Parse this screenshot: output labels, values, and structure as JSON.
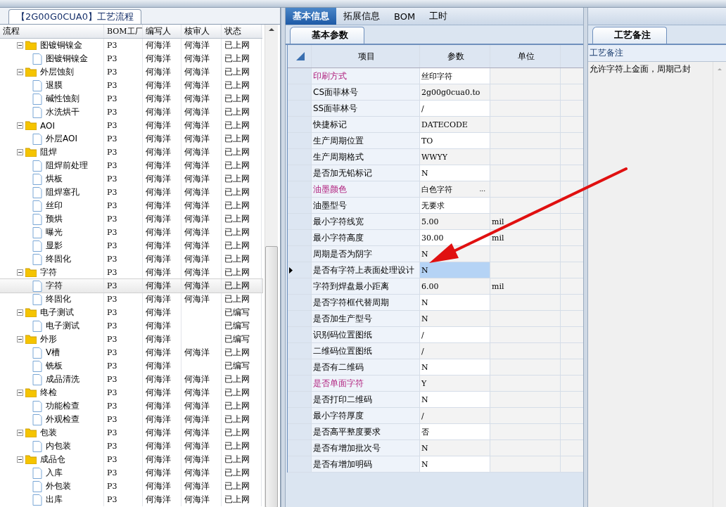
{
  "flow_panel": {
    "title": "【2G00G0CUA0】工艺流程",
    "columns": [
      "流程",
      "BOM工厂",
      "编写人",
      "核审人",
      "状态"
    ],
    "groups": [
      {
        "name": "图镀铜镍金",
        "bom": "P3",
        "writer": "何海洋",
        "reviewer": "何海洋",
        "status": "已上网",
        "expanded": true,
        "selected": false,
        "children": [
          {
            "name": "图镀铜镍金",
            "bom": "P3",
            "writer": "何海洋",
            "reviewer": "何海洋",
            "status": "已上网",
            "selected": false
          }
        ]
      },
      {
        "name": "外层蚀刻",
        "bom": "P3",
        "writer": "何海洋",
        "reviewer": "何海洋",
        "status": "已上网",
        "expanded": true,
        "selected": false,
        "children": [
          {
            "name": "退膜",
            "bom": "P3",
            "writer": "何海洋",
            "reviewer": "何海洋",
            "status": "已上网",
            "selected": false
          },
          {
            "name": "碱性蚀刻",
            "bom": "P3",
            "writer": "何海洋",
            "reviewer": "何海洋",
            "status": "已上网",
            "selected": false
          },
          {
            "name": "水洗烘干",
            "bom": "P3",
            "writer": "何海洋",
            "reviewer": "何海洋",
            "status": "已上网",
            "selected": false
          }
        ]
      },
      {
        "name": "AOI",
        "bom": "P3",
        "writer": "何海洋",
        "reviewer": "何海洋",
        "status": "已上网",
        "expanded": true,
        "selected": false,
        "children": [
          {
            "name": "外层AOI",
            "bom": "P3",
            "writer": "何海洋",
            "reviewer": "何海洋",
            "status": "已上网",
            "selected": false
          }
        ]
      },
      {
        "name": "阻焊",
        "bom": "P3",
        "writer": "何海洋",
        "reviewer": "何海洋",
        "status": "已上网",
        "expanded": true,
        "selected": false,
        "children": [
          {
            "name": "阻焊前处理",
            "bom": "P3",
            "writer": "何海洋",
            "reviewer": "何海洋",
            "status": "已上网",
            "selected": false
          },
          {
            "name": "烘板",
            "bom": "P3",
            "writer": "何海洋",
            "reviewer": "何海洋",
            "status": "已上网",
            "selected": false
          },
          {
            "name": "阻焊塞孔",
            "bom": "P3",
            "writer": "何海洋",
            "reviewer": "何海洋",
            "status": "已上网",
            "selected": false
          },
          {
            "name": "丝印",
            "bom": "P3",
            "writer": "何海洋",
            "reviewer": "何海洋",
            "status": "已上网",
            "selected": false
          },
          {
            "name": "预烘",
            "bom": "P3",
            "writer": "何海洋",
            "reviewer": "何海洋",
            "status": "已上网",
            "selected": false
          },
          {
            "name": "曝光",
            "bom": "P3",
            "writer": "何海洋",
            "reviewer": "何海洋",
            "status": "已上网",
            "selected": false
          },
          {
            "name": "显影",
            "bom": "P3",
            "writer": "何海洋",
            "reviewer": "何海洋",
            "status": "已上网",
            "selected": false
          },
          {
            "name": "终固化",
            "bom": "P3",
            "writer": "何海洋",
            "reviewer": "何海洋",
            "status": "已上网",
            "selected": false
          }
        ]
      },
      {
        "name": "字符",
        "bom": "P3",
        "writer": "何海洋",
        "reviewer": "何海洋",
        "status": "已上网",
        "expanded": true,
        "selected": false,
        "children": [
          {
            "name": "字符",
            "bom": "P3",
            "writer": "何海洋",
            "reviewer": "何海洋",
            "status": "已上网",
            "selected": true
          },
          {
            "name": "终固化",
            "bom": "P3",
            "writer": "何海洋",
            "reviewer": "何海洋",
            "status": "已上网",
            "selected": false
          }
        ]
      },
      {
        "name": "电子测试",
        "bom": "P3",
        "writer": "何海洋",
        "status": "已编写",
        "expanded": true,
        "selected": false,
        "children": [
          {
            "name": "电子测试",
            "bom": "P3",
            "writer": "何海洋",
            "status": "已编写",
            "selected": false
          }
        ]
      },
      {
        "name": "外形",
        "bom": "P3",
        "writer": "何海洋",
        "status": "已编写",
        "expanded": true,
        "selected": false,
        "children": [
          {
            "name": "V槽",
            "bom": "P3",
            "writer": "何海洋",
            "reviewer": "何海洋",
            "status": "已上网",
            "selected": false
          },
          {
            "name": "铣板",
            "bom": "P3",
            "writer": "何海洋",
            "status": "已编写",
            "selected": false
          },
          {
            "name": "成品清洗",
            "bom": "P3",
            "writer": "何海洋",
            "reviewer": "何海洋",
            "status": "已上网",
            "selected": false
          }
        ]
      },
      {
        "name": "终检",
        "bom": "P3",
        "writer": "何海洋",
        "reviewer": "何海洋",
        "status": "已上网",
        "expanded": true,
        "selected": false,
        "children": [
          {
            "name": "功能检查",
            "bom": "P3",
            "writer": "何海洋",
            "reviewer": "何海洋",
            "status": "已上网",
            "selected": false
          },
          {
            "name": "外观检查",
            "bom": "P3",
            "writer": "何海洋",
            "reviewer": "何海洋",
            "status": "已上网",
            "selected": false
          }
        ]
      },
      {
        "name": "包装",
        "bom": "P3",
        "writer": "何海洋",
        "reviewer": "何海洋",
        "status": "已上网",
        "expanded": true,
        "selected": false,
        "children": [
          {
            "name": "内包装",
            "bom": "P3",
            "writer": "何海洋",
            "reviewer": "何海洋",
            "status": "已上网",
            "selected": false
          }
        ]
      },
      {
        "name": "成品仓",
        "bom": "P3",
        "writer": "何海洋",
        "reviewer": "何海洋",
        "status": "已上网",
        "expanded": true,
        "selected": false,
        "children": [
          {
            "name": "入库",
            "bom": "P3",
            "writer": "何海洋",
            "reviewer": "何海洋",
            "status": "已上网",
            "selected": false
          },
          {
            "name": "外包装",
            "bom": "P3",
            "writer": "何海洋",
            "reviewer": "何海洋",
            "status": "已上网",
            "selected": false
          },
          {
            "name": "出库",
            "bom": "P3",
            "writer": "何海洋",
            "reviewer": "何海洋",
            "status": "已上网",
            "selected": false
          }
        ]
      }
    ]
  },
  "tabs": [
    {
      "label": "基本信息",
      "selected": true
    },
    {
      "label": "拓展信息",
      "selected": false
    },
    {
      "label": "BOM",
      "selected": false
    },
    {
      "label": "工时",
      "selected": false
    }
  ],
  "params_panel": {
    "subtab": "基本参数",
    "columns": [
      "项目",
      "参数",
      "单位"
    ],
    "rows": [
      {
        "item": "印刷方式",
        "value": "丝印字符",
        "emphasized": true,
        "current": false
      },
      {
        "item": "CS面菲林号",
        "value": "2g00g0cua0.to",
        "emphasized": false,
        "current": false
      },
      {
        "item": "SS面菲林号",
        "value": "/",
        "emphasized": false,
        "current": false
      },
      {
        "item": "快捷标记",
        "value": "DATECODE",
        "emphasized": false,
        "current": false
      },
      {
        "item": "生产周期位置",
        "value": "TO",
        "emphasized": false,
        "current": false
      },
      {
        "item": "生产周期格式",
        "value": "WWYY",
        "emphasized": false,
        "current": false
      },
      {
        "item": "是否加无铅标记",
        "value": "N",
        "emphasized": false,
        "current": false
      },
      {
        "item": "油墨颜色",
        "value": "白色字符",
        "button": "...",
        "emphasized": true,
        "current": false
      },
      {
        "item": "油墨型号",
        "value": "无要求",
        "emphasized": false,
        "current": false
      },
      {
        "item": "最小字符线宽",
        "value": "5.00",
        "unit": "mil",
        "emphasized": false,
        "current": false
      },
      {
        "item": "最小字符高度",
        "value": "30.00",
        "unit": "mil",
        "emphasized": false,
        "current": false
      },
      {
        "item": "周期是否为阴字",
        "value": "N",
        "emphasized": false,
        "current": false
      },
      {
        "item": "是否有字符上表面处理设计",
        "value": "N",
        "emphasized": false,
        "current": true
      },
      {
        "item": "字符到焊盘最小距离",
        "value": "6.00",
        "unit": "mil",
        "emphasized": false,
        "current": false
      },
      {
        "item": "是否字符框代替周期",
        "value": "N",
        "emphasized": false,
        "current": false
      },
      {
        "item": "是否加生产型号",
        "value": "N",
        "emphasized": false,
        "current": false
      },
      {
        "item": "识别码位置图纸",
        "value": "/",
        "emphasized": false,
        "current": false
      },
      {
        "item": "二维码位置图纸",
        "value": "/",
        "emphasized": false,
        "current": false
      },
      {
        "item": "是否有二维码",
        "value": "N",
        "emphasized": false,
        "current": false
      },
      {
        "item": "是否单面字符",
        "value": "Y",
        "emphasized": true,
        "current": false
      },
      {
        "item": "是否打印二维码",
        "value": "N",
        "emphasized": false,
        "current": false
      },
      {
        "item": "最小字符厚度",
        "value": "/",
        "emphasized": false,
        "current": false
      },
      {
        "item": "是否高平整度要求",
        "value": "否",
        "emphasized": false,
        "current": false
      },
      {
        "item": "是否有增加批次号",
        "value": "N",
        "emphasized": false,
        "current": false
      },
      {
        "item": "是否有增加明码",
        "value": "N",
        "emphasized": false,
        "current": false
      }
    ]
  },
  "notes_panel": {
    "subtab": "工艺备注",
    "header": "工艺备注",
    "text": "允许字符上金面，周期己封"
  }
}
